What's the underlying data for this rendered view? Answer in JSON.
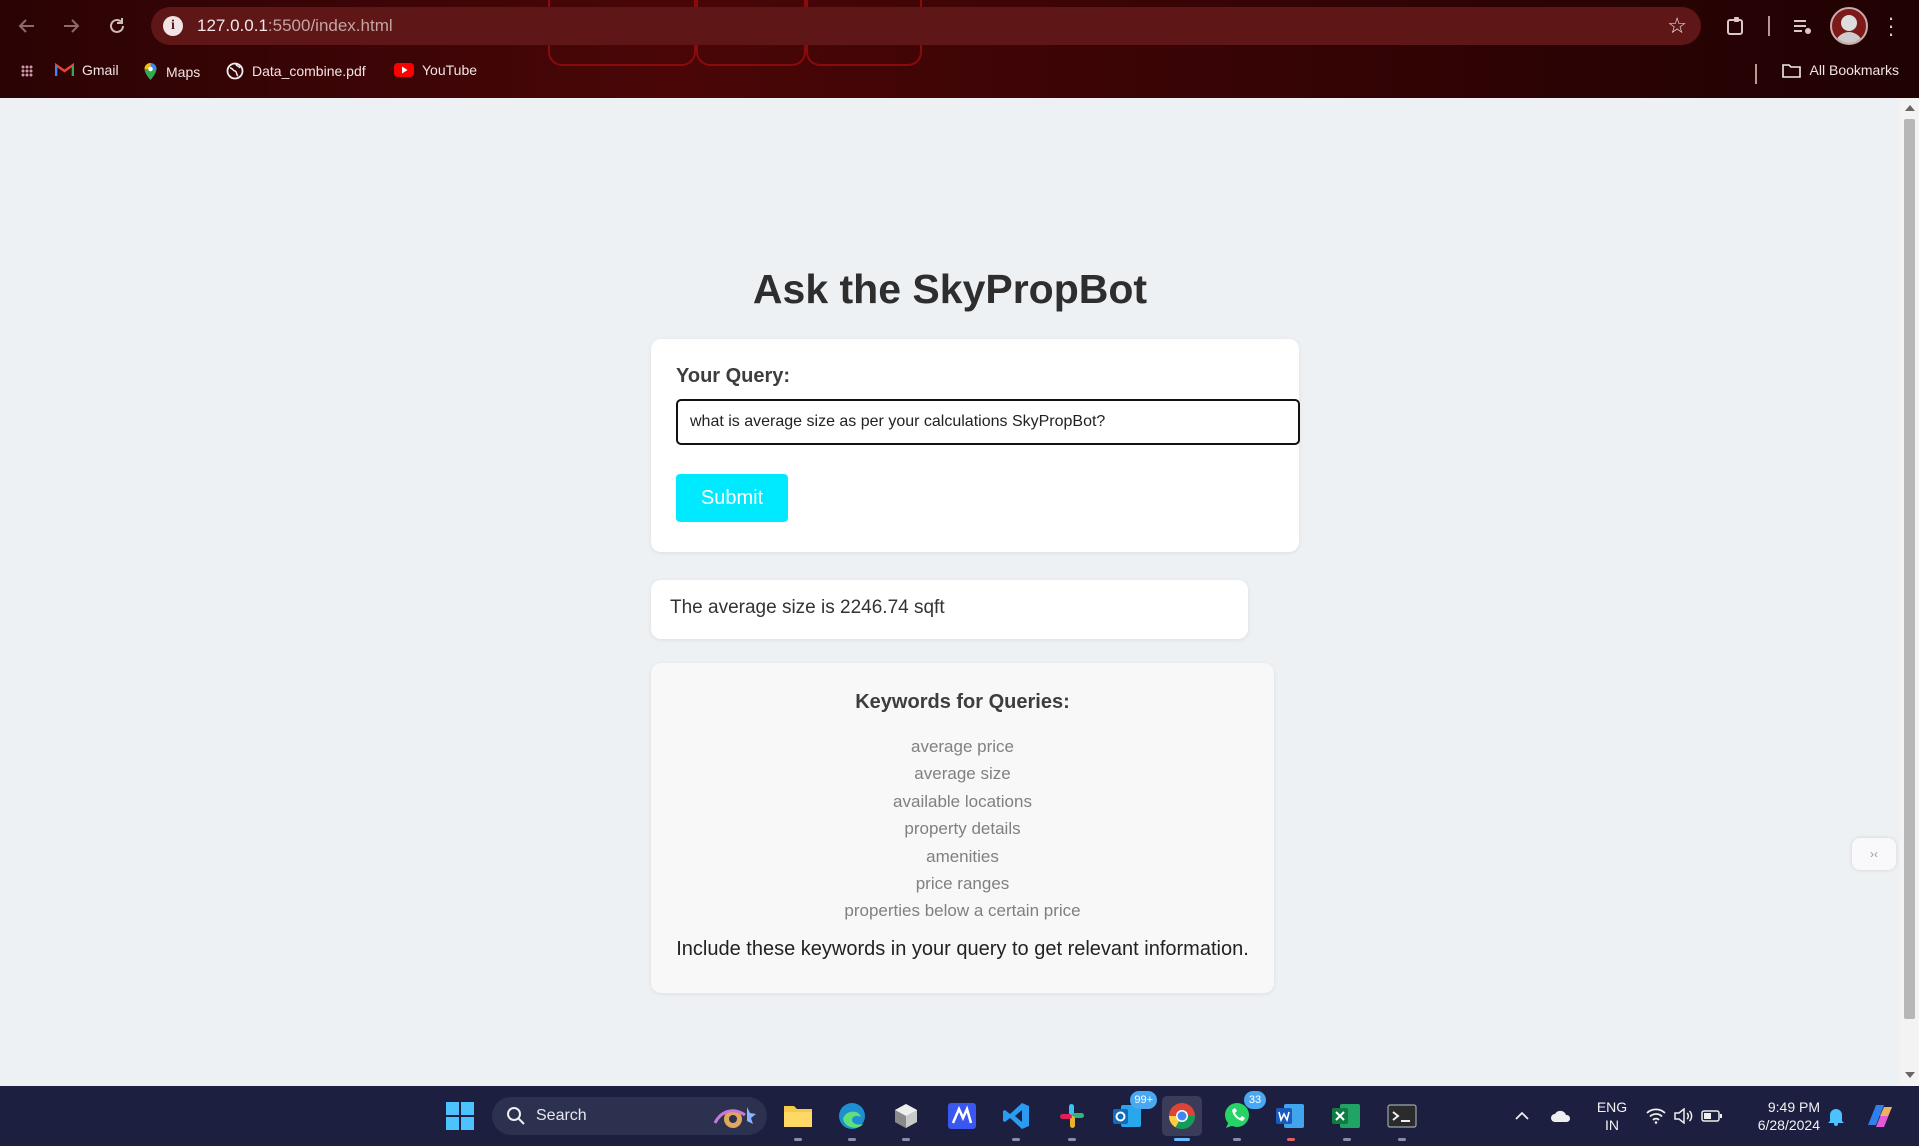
{
  "browser": {
    "url_host": "127.0.0.1",
    "url_path": ":5500/index.html",
    "bookmarks": [
      {
        "label": "Gmail",
        "icon": "gmail-icon"
      },
      {
        "label": "Maps",
        "icon": "maps-icon"
      },
      {
        "label": "Data_combine.pdf",
        "icon": "globe-icon"
      },
      {
        "label": "YouTube",
        "icon": "youtube-icon"
      }
    ],
    "all_bookmarks_label": "All Bookmarks"
  },
  "page": {
    "title": "Ask the SkyPropBot",
    "query_label": "Your Query:",
    "query_value": "what is average size as per your calculations SkyPropBot?",
    "submit_label": "Submit",
    "answer": "The average size is 2246.74 sqft",
    "keywords_title": "Keywords for Queries:",
    "keywords": [
      "average price",
      "average size",
      "available locations",
      "property details",
      "amenities",
      "price ranges",
      "properties below a certain price"
    ],
    "keywords_note": "Include these keywords in your query to get relevant information."
  },
  "taskbar": {
    "search_label": "Search",
    "outlook_badge": "99+",
    "whatsapp_badge": "33",
    "lang_line1": "ENG",
    "lang_line2": "IN",
    "time": "9:49 PM",
    "date": "6/28/2024"
  },
  "colors": {
    "submit_button": "#00eaff",
    "page_background": "#eef1f4",
    "browser_frame": "#4a0607",
    "taskbar": "#1c1f3f"
  }
}
